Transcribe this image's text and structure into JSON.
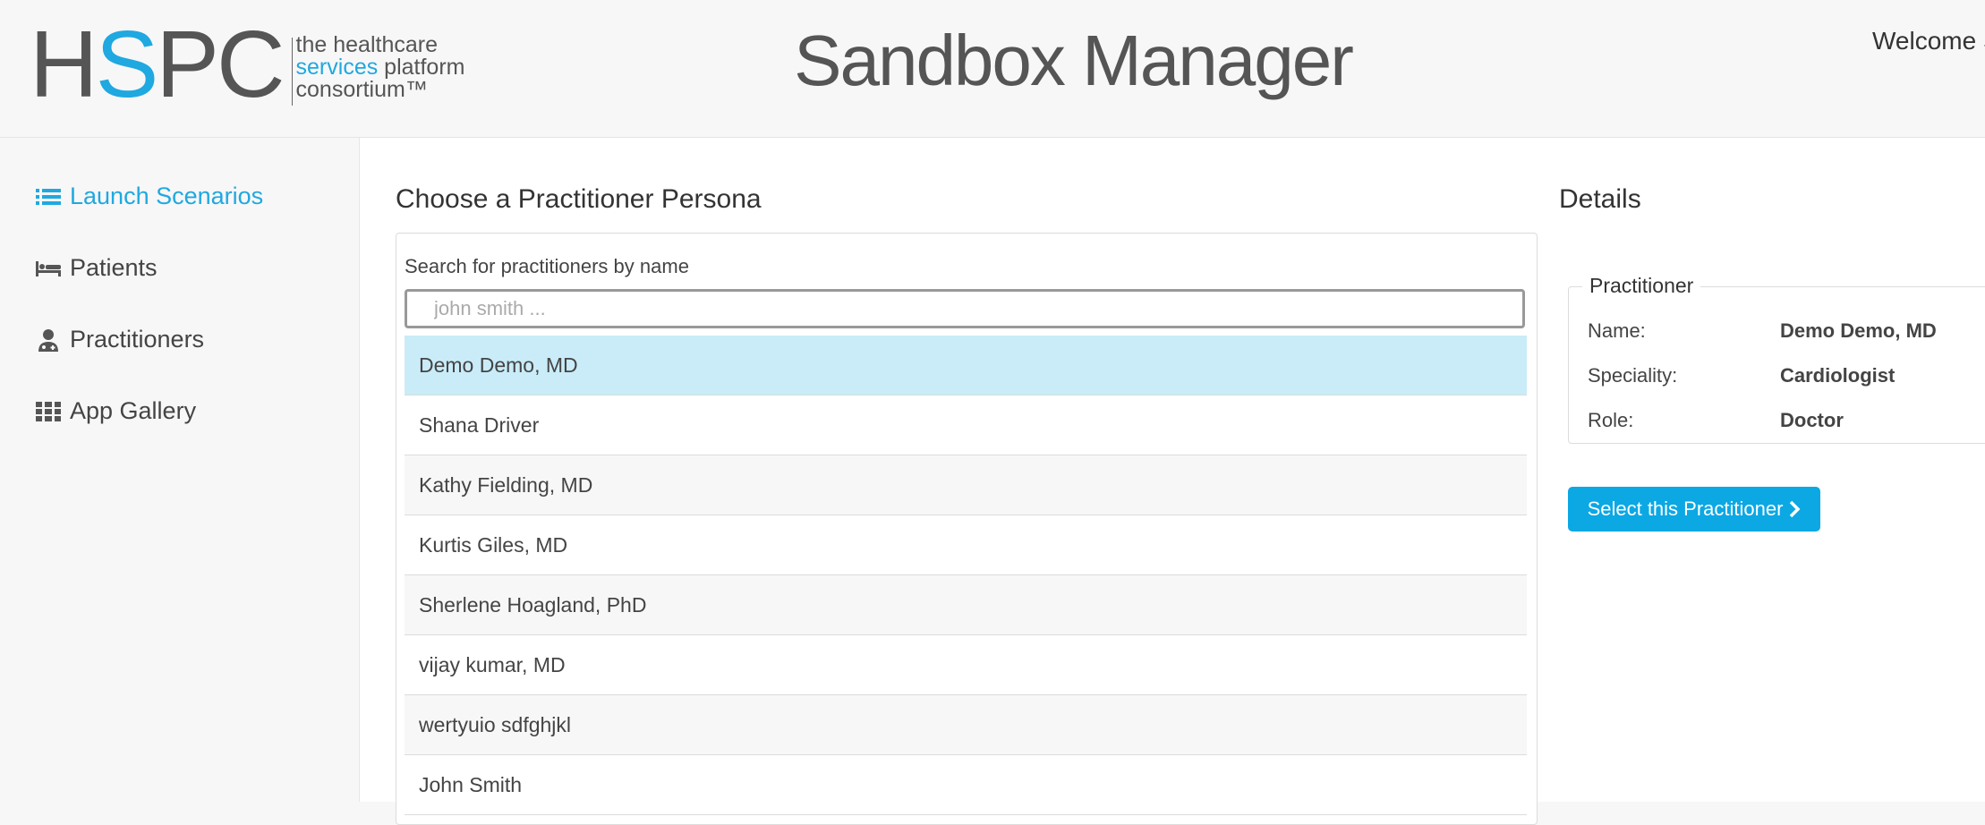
{
  "header": {
    "logo_mark_h": "H",
    "logo_mark_s": "S",
    "logo_mark_pc": "PC",
    "logo_line1": "the healthcare",
    "logo_line2_services": "services",
    "logo_line2_rest": " platform",
    "logo_line3": "consortium™",
    "title": "Sandbox Manager",
    "welcome": "Welcome S"
  },
  "sidebar": {
    "items": [
      {
        "label": "Launch Scenarios",
        "icon": "list-icon",
        "active": true
      },
      {
        "label": "Patients",
        "icon": "bed-icon",
        "active": false
      },
      {
        "label": "Practitioners",
        "icon": "user-md-icon",
        "active": false
      },
      {
        "label": "App Gallery",
        "icon": "grid-icon",
        "active": false
      }
    ]
  },
  "main": {
    "title": "Choose a Practitioner Persona",
    "search_label": "Search for practitioners by name",
    "search_placeholder": "john smith ...",
    "search_value": "",
    "practitioners": [
      "Demo Demo, MD",
      "Shana Driver",
      "Kathy Fielding, MD",
      "Kurtis Giles, MD",
      "Sherlene Hoagland, PhD",
      "vijay kumar, MD",
      "wertyuio sdfghjkl",
      "John Smith"
    ],
    "selected_index": 0
  },
  "details": {
    "title": "Details",
    "legend": "Practitioner",
    "name_label": "Name:",
    "name_value": "Demo Demo, MD",
    "speciality_label": "Speciality:",
    "speciality_value": "Cardiologist",
    "role_label": "Role:",
    "role_value": "Doctor",
    "select_button": "Select this Practitioner"
  },
  "colors": {
    "accent": "#20a8e0",
    "button": "#0ba8e4",
    "selected_row": "#c9ecf8"
  }
}
